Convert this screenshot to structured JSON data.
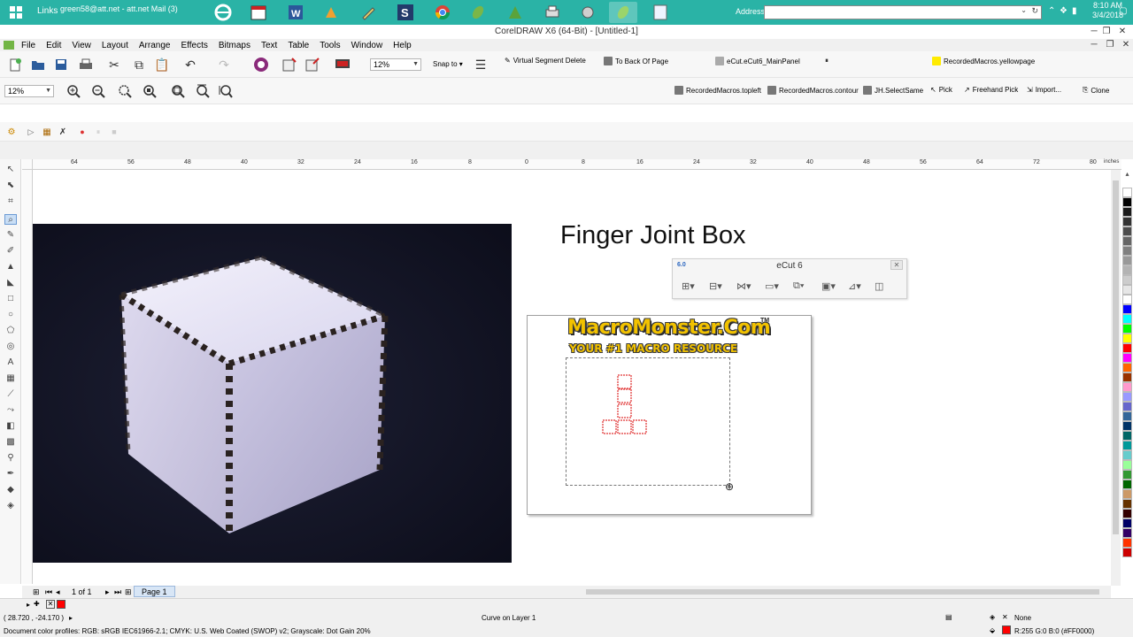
{
  "taskbar": {
    "links_label": "Links",
    "mail_label": "green58@att.net - att.net Mail (3)",
    "address_label": "Address",
    "clock_time": "8:10 AM",
    "clock_date": "3/4/2018"
  },
  "window": {
    "title": "CorelDRAW X6 (64-Bit) - [Untitled-1]"
  },
  "menu": {
    "items": [
      "File",
      "Edit",
      "View",
      "Layout",
      "Arrange",
      "Effects",
      "Bitmaps",
      "Text",
      "Table",
      "Tools",
      "Window",
      "Help"
    ]
  },
  "standard_toolbar": {
    "zoom_level": "12%",
    "snap_to_label": "Snap to",
    "macro_virtual_segment_delete": "Virtual Segment Delete",
    "macro_to_back_of_page": "To Back Of Page",
    "macro_ecut_mainpanel": "eCut.eCut6_MainPanel",
    "macro_yellowpage": "RecordedMacros.yellowpage"
  },
  "zoom_toolbar": {
    "zoom_level": "12%",
    "macros": [
      "RecordedMacros.topleft",
      "RecordedMacros.contour",
      "JH.SelectSame",
      "Pick",
      "Freehand Pick",
      "Import...",
      "Clone"
    ]
  },
  "ruler": {
    "unit": "inches",
    "labels": [
      "64",
      "56",
      "48",
      "40",
      "32",
      "24",
      "16",
      "8",
      "0",
      "8",
      "16",
      "24",
      "32",
      "40",
      "48",
      "56",
      "64",
      "72",
      "80"
    ]
  },
  "document": {
    "title": "Finger Joint Box",
    "logo_line1": "MacroMonster.Com",
    "logo_tm": "TM",
    "logo_line2": "YOUR #1 MACRO RESOURCE"
  },
  "ecut_panel": {
    "title": "eCut 6",
    "logo": "6.0",
    "close": "✕"
  },
  "page_nav": {
    "page_count": "1 of 1",
    "page_tab": "Page 1"
  },
  "status": {
    "coordinates": "( 28.720 , -24.170 )",
    "object_info": "Curve on Layer 1",
    "color_profiles": "Document color profiles: RGB: sRGB IEC61966-2.1; CMYK: U.S. Web Coated (SWOP) v2; Grayscale: Dot Gain 20%",
    "outline": "None",
    "fill": "R:255 G:0 B:0 (#FF0000)"
  },
  "colors": {
    "taskbar": "#2ab3a6",
    "accent_red": "#ff0000",
    "logo_yellow": "#f2c200"
  },
  "palette": [
    "#ffffff",
    "#000000",
    "#1a1a1a",
    "#333333",
    "#4d4d4d",
    "#666666",
    "#808080",
    "#999999",
    "#b3b3b3",
    "#cccccc",
    "#e6e6e6",
    "#ffffff",
    "#0000ff",
    "#00ffff",
    "#00ff00",
    "#ffff00",
    "#ff0000",
    "#ff00ff",
    "#ff6600",
    "#993300",
    "#ff99cc",
    "#9999ff",
    "#6666cc",
    "#336699",
    "#003366",
    "#006666",
    "#009999",
    "#66cccc",
    "#99ff99",
    "#339933",
    "#006600",
    "#cc9966",
    "#663300",
    "#330000",
    "#000066",
    "#330066",
    "#ff3300",
    "#cc0000"
  ]
}
